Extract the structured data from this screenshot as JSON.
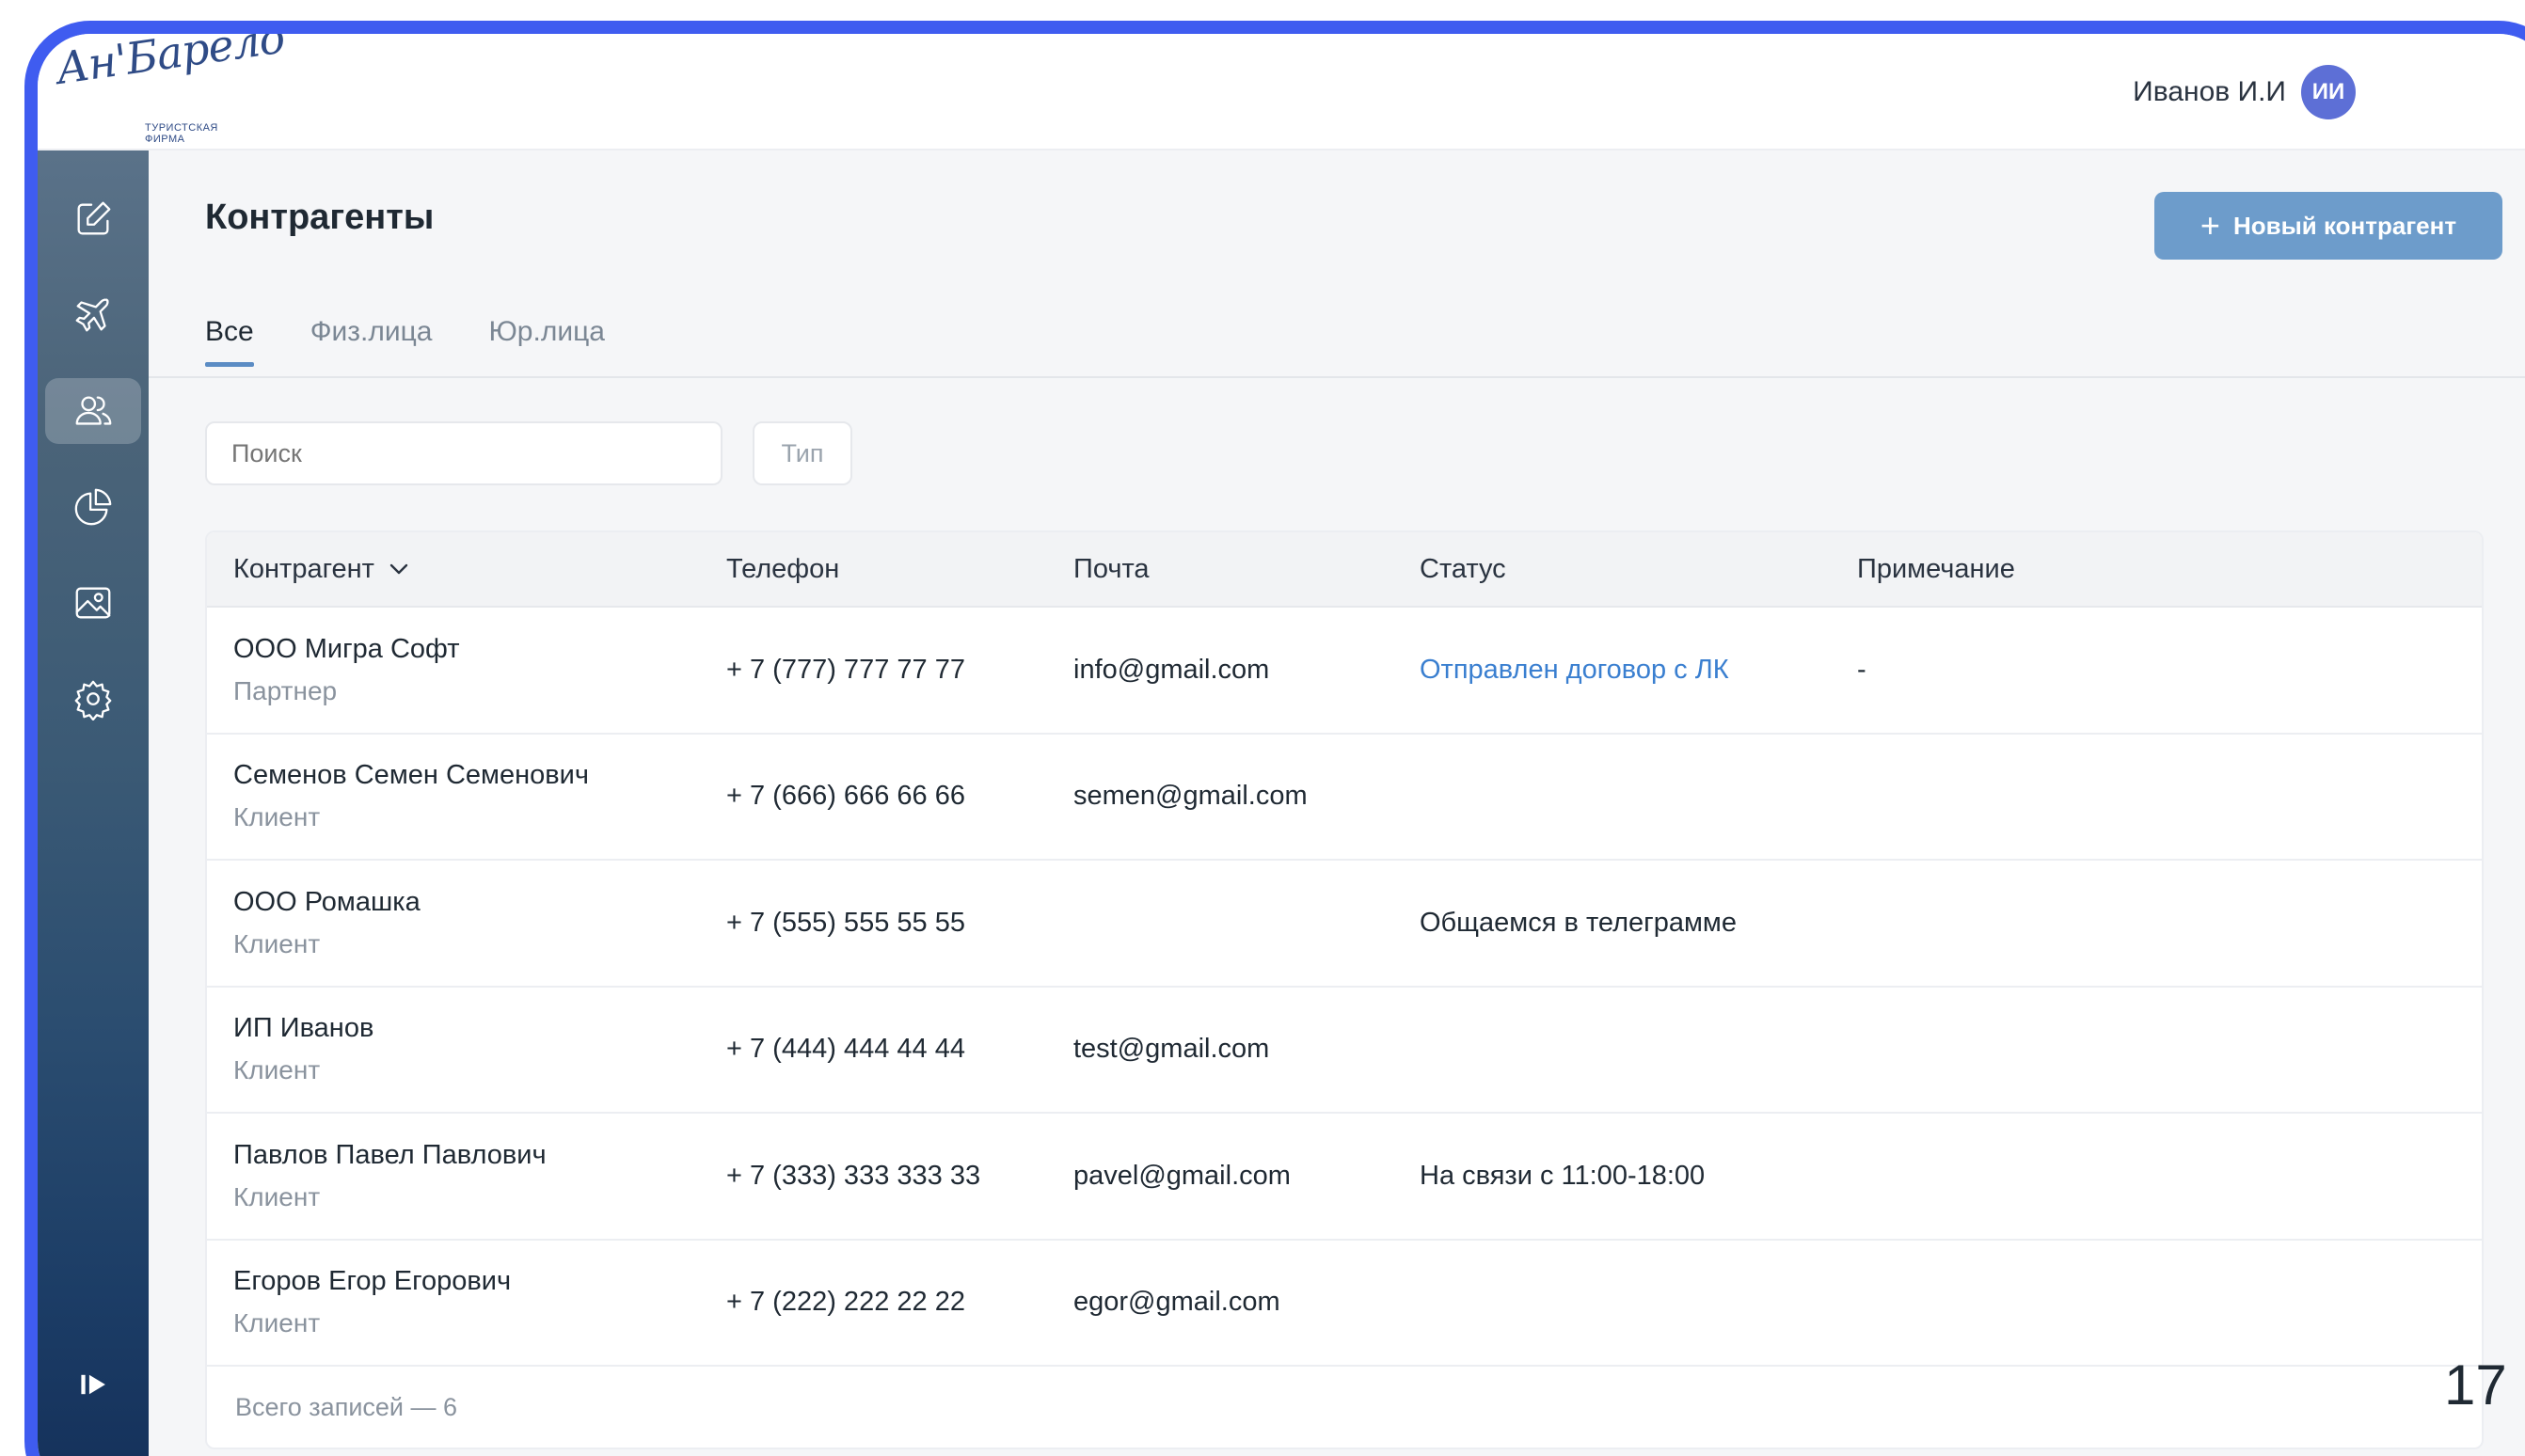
{
  "app": {
    "logo_text": "Ан'Барело",
    "logo_subtitle": "ТУРИСТСКАЯ ФИРМА"
  },
  "user": {
    "name": "Иванов И.И",
    "initials": "ИИ"
  },
  "sidebar": {
    "items": [
      {
        "icon": "edit-icon",
        "active": false
      },
      {
        "icon": "airplane-icon",
        "active": false
      },
      {
        "icon": "users-icon",
        "active": true
      },
      {
        "icon": "pie-chart-icon",
        "active": false
      },
      {
        "icon": "image-icon",
        "active": false
      },
      {
        "icon": "gear-icon",
        "active": false
      }
    ],
    "expand_icon": "expand-sidebar-icon"
  },
  "page": {
    "title": "Контрагенты",
    "new_button_label": "Новый контрагент",
    "tabs": [
      {
        "label": "Все",
        "active": true
      },
      {
        "label": "Физ.лица",
        "active": false
      },
      {
        "label": "Юр.лица",
        "active": false
      }
    ],
    "search_placeholder": "Поиск",
    "type_filter_label": "Тип"
  },
  "table": {
    "columns": [
      "Контрагент",
      "Телефон",
      "Почта",
      "Статус",
      "Примечание"
    ],
    "rows": [
      {
        "name": "ООО Мигра Софт",
        "role": "Партнер",
        "phone": "+ 7 (777) 777 77 77",
        "email": "info@gmail.com",
        "status": "Отправлен договор с ЛК",
        "note": "-"
      },
      {
        "name": "Семенов Семен Семенович",
        "role": "Клиент",
        "phone": "+ 7 (666) 666 66 66",
        "email": "semen@gmail.com",
        "status": "",
        "note": ""
      },
      {
        "name": "ООО Ромашка",
        "role": "Клиент",
        "phone": "+ 7 (555) 555 55 55",
        "email": "",
        "status": "Общаемся в телеграмме",
        "note": ""
      },
      {
        "name": "ИП Иванов",
        "role": "Клиент",
        "phone": "+ 7 (444) 444 44 44",
        "email": "test@gmail.com",
        "status": "",
        "note": ""
      },
      {
        "name": "Павлов Павел Павлович",
        "role": "Клиент",
        "phone": "+ 7 (333) 333 333 33",
        "email": "pavel@gmail.com",
        "status": "На связи с 11:00-18:00",
        "note": ""
      },
      {
        "name": "Егоров Егор Егорович",
        "role": "Клиент",
        "phone": "+ 7 (222) 222 22 22",
        "email": "egor@gmail.com",
        "status": "",
        "note": ""
      }
    ],
    "footer": "Всего записей — 6"
  },
  "slide_number": "17",
  "colors": {
    "frame": "#3f5cf0",
    "accent": "#5b8cc4",
    "button": "#6d9ccb",
    "link": "#3a7fd0",
    "avatar": "#5d6fd6"
  }
}
